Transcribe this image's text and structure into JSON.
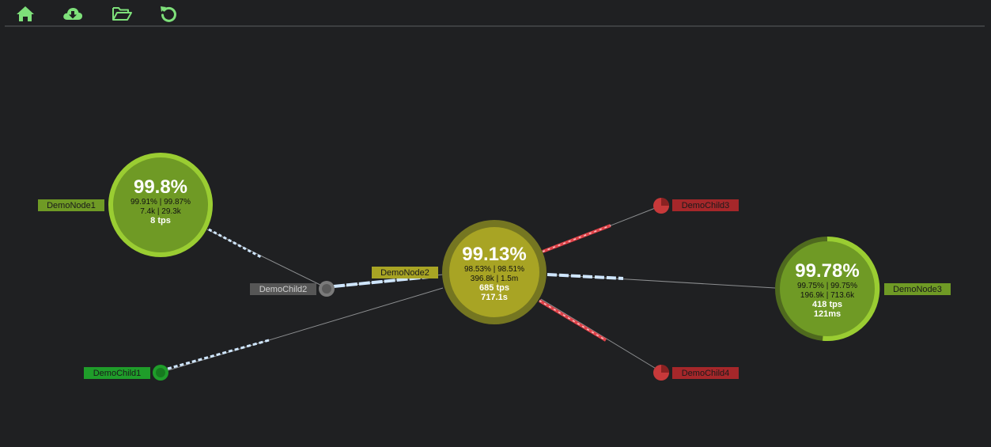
{
  "toolbar": {
    "buttons": [
      {
        "name": "home-icon"
      },
      {
        "name": "cloud-download-icon"
      },
      {
        "name": "folder-open-icon"
      },
      {
        "name": "refresh-icon"
      }
    ],
    "icon_color": "#7ee07a"
  },
  "colors": {
    "background": "#1f2022",
    "healthy": "#7a9a22",
    "warning": "#a8a424",
    "error": "#c7393a",
    "traffic": "#cfe6ff"
  },
  "nodes": {
    "node1": {
      "label": "DemoNode1",
      "percent": "99.8%",
      "line1": "99.91% | 99.87%",
      "line2": "7.4k | 29.3k",
      "line3": "8 tps",
      "line4": ""
    },
    "node2": {
      "label": "DemoNode2",
      "percent": "99.13%",
      "line1": "98.53% | 98.51%",
      "line2": "396.8k | 1.5m",
      "line3": "685 tps",
      "line4": "717.1s"
    },
    "node3": {
      "label": "DemoNode3",
      "percent": "99.78%",
      "line1": "99.75% | 99.75%",
      "line2": "196.9k | 713.6k",
      "line3": "418 tps",
      "line4": "121ms"
    },
    "child1": {
      "label": "DemoChild1"
    },
    "child2": {
      "label": "DemoChild2"
    },
    "child3": {
      "label": "DemoChild3"
    },
    "child4": {
      "label": "DemoChild4"
    }
  }
}
